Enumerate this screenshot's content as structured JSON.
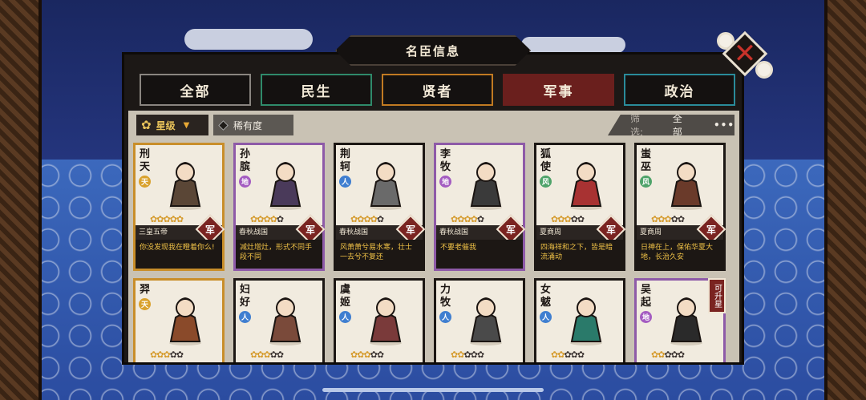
{
  "window": {
    "title": "名臣信息"
  },
  "tabs": [
    {
      "label": "全部"
    },
    {
      "label": "民生"
    },
    {
      "label": "贤者"
    },
    {
      "label": "军事"
    },
    {
      "label": "政治"
    }
  ],
  "active_tab": "军事",
  "filters": {
    "sort_label": "星级",
    "rarity_label": "稀有度",
    "screen_label": "筛选:",
    "screen_value": "全部",
    "more": "•••"
  },
  "colors": {
    "accent_red": "#6a1f1d",
    "gold": "#d59a2b",
    "panel": "#1c1816"
  },
  "cards": [
    {
      "name": "刑天",
      "rank": "天",
      "rank_type": "heaven",
      "stars_on": 5,
      "era": "三皇五帝",
      "badge": "军",
      "quote": "你没发现我在瞪着你么!",
      "border": "gold"
    },
    {
      "name": "孙膑",
      "rank": "地",
      "rank_type": "earth",
      "stars_on": 4,
      "era": "春秋战国",
      "badge": "军",
      "quote": "减灶增灶，形式不同手段不同",
      "border": "purple"
    },
    {
      "name": "荆轲",
      "rank": "人",
      "rank_type": "human",
      "stars_on": 4,
      "era": "春秋战国",
      "badge": "军",
      "quote": "风萧萧兮易水寒，壮士一去兮不复还",
      "border": "none"
    },
    {
      "name": "李牧",
      "rank": "地",
      "rank_type": "earth",
      "stars_on": 4,
      "era": "春秋战国",
      "badge": "军",
      "quote": "不要老催我",
      "border": "purple"
    },
    {
      "name": "狐使",
      "rank": "风",
      "rank_type": "wind",
      "stars_on": 3,
      "era": "夏商周",
      "badge": "军",
      "quote": "四海祥和之下，皆是暗流涌动",
      "border": "none"
    },
    {
      "name": "蚩巫",
      "rank": "风",
      "rank_type": "wind",
      "stars_on": 3,
      "era": "夏商周",
      "badge": "军",
      "quote": "日神在上，保佑华夏大地，长治久安",
      "border": "none"
    },
    {
      "name": "羿",
      "rank": "天",
      "rank_type": "heaven",
      "stars_on": 3,
      "era": "",
      "badge": "",
      "quote": "",
      "border": "gold"
    },
    {
      "name": "妇好",
      "rank": "人",
      "rank_type": "human",
      "stars_on": 3,
      "era": "",
      "badge": "",
      "quote": "",
      "border": "none"
    },
    {
      "name": "虞姬",
      "rank": "人",
      "rank_type": "human",
      "stars_on": 3,
      "era": "",
      "badge": "",
      "quote": "",
      "border": "none"
    },
    {
      "name": "力牧",
      "rank": "人",
      "rank_type": "human",
      "stars_on": 2,
      "era": "",
      "badge": "",
      "quote": "",
      "border": "none"
    },
    {
      "name": "女魃",
      "rank": "人",
      "rank_type": "human",
      "stars_on": 2,
      "era": "",
      "badge": "",
      "quote": "",
      "border": "none"
    },
    {
      "name": "吴起",
      "rank": "地",
      "rank_type": "earth",
      "stars_on": 2,
      "era": "",
      "badge": "",
      "quote": "",
      "border": "purple",
      "upgrade": "可升星"
    }
  ]
}
